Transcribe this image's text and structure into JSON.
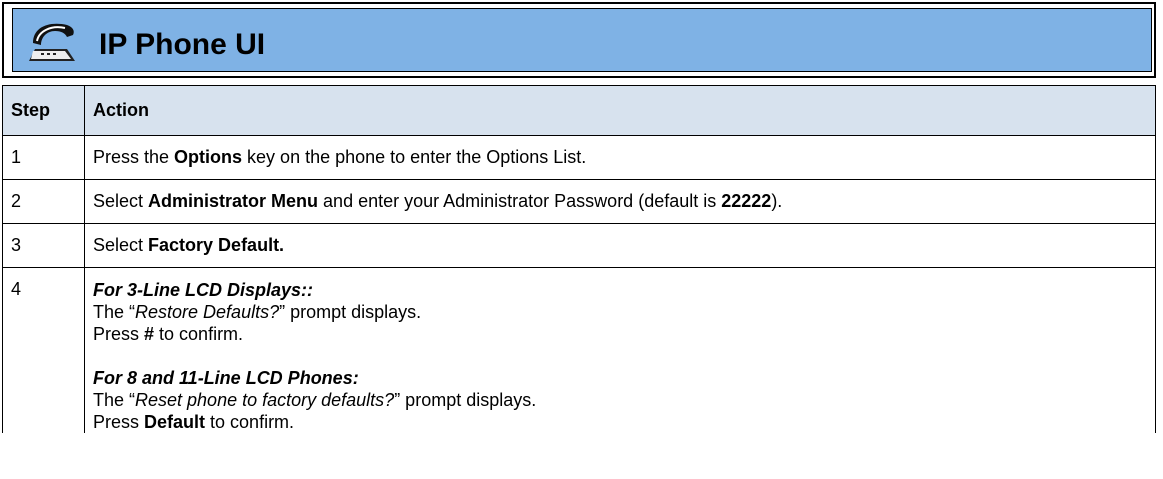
{
  "banner": {
    "title": "IP Phone UI",
    "icon": "desk-phone-icon"
  },
  "table": {
    "headers": {
      "step": "Step",
      "action": "Action"
    },
    "row1": {
      "step": "1",
      "pre": "Press the ",
      "key": "Options",
      "post": " key on the phone to enter the Options List."
    },
    "row2": {
      "step": "2",
      "pre": "Select ",
      "menu": "Administrator Menu",
      "mid": " and enter your Administrator Password (default is ",
      "password": "22222",
      "post": ")."
    },
    "row3": {
      "step": "3",
      "pre": "Select ",
      "item": "Factory Default."
    },
    "row4": {
      "step": "4",
      "section_a": {
        "heading": "For 3-Line LCD Displays::",
        "prompt_pre": "The “",
        "prompt": "Restore Defaults?",
        "prompt_post": "” prompt displays.",
        "confirm_pre": "Press ",
        "confirm_key": "#",
        "confirm_post": " to confirm."
      },
      "section_b": {
        "heading": "For 8 and 11-Line LCD Phones:",
        "prompt_pre": "The “",
        "prompt": "Reset phone to factory defaults?",
        "prompt_post": "” prompt displays.",
        "confirm_pre": "Press ",
        "confirm_key": "Default",
        "confirm_post": " to confirm."
      }
    }
  }
}
